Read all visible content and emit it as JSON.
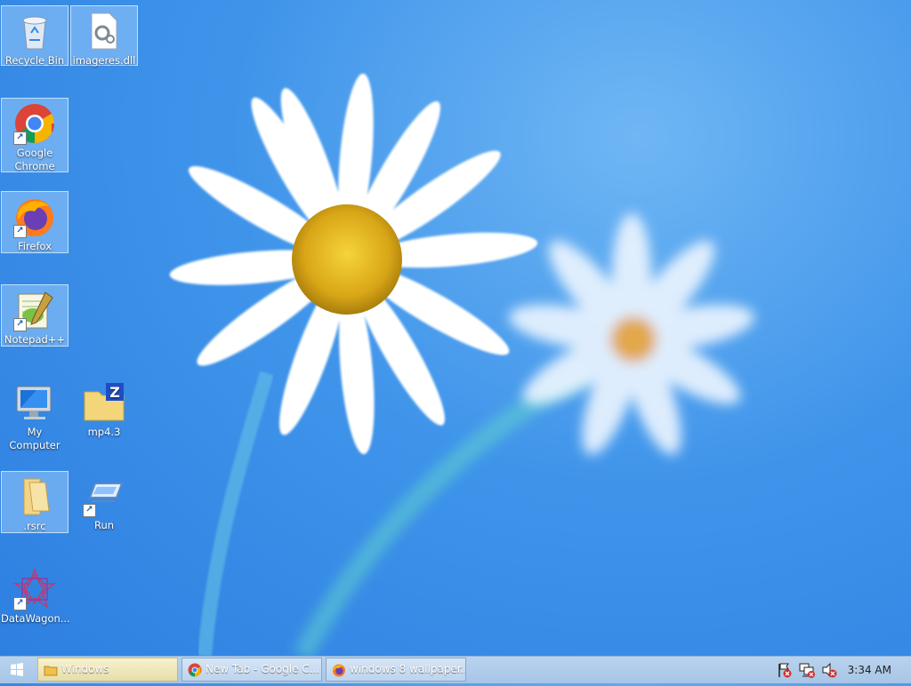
{
  "desktop": {
    "icons": [
      {
        "label": "Recycle Bin",
        "icon": "recycle-bin-icon"
      },
      {
        "label": "imageres.dll",
        "icon": "dll-file-icon"
      },
      {
        "label": "Google Chrome",
        "icon": "chrome-icon"
      },
      {
        "label": "Firefox",
        "icon": "firefox-icon"
      },
      {
        "label": "Notepad++",
        "icon": "notepad-plus-plus-icon"
      },
      {
        "label": "My Computer",
        "icon": "computer-icon"
      },
      {
        "label": "mp4.3",
        "icon": "zip-folder-icon"
      },
      {
        "label": ".rsrc",
        "icon": "folder-icon"
      },
      {
        "label": "Run",
        "icon": "run-icon"
      },
      {
        "label": "DataWagon...",
        "icon": "datawagon-icon"
      }
    ]
  },
  "taskbar": {
    "start_icon": "windows-logo-icon",
    "buttons": [
      {
        "label": "Windows",
        "icon": "folder-icon"
      },
      {
        "label": "New Tab - Google C...",
        "icon": "chrome-icon"
      },
      {
        "label": "windows 8 wallpaper...",
        "icon": "firefox-icon"
      }
    ],
    "tray": {
      "icons": [
        "action-center-flag-icon",
        "network-icon",
        "volume-muted-icon"
      ],
      "time": "3:34 AM"
    }
  },
  "colors": {
    "wallpaper_blue": "#3f94ea",
    "taskbar": "#a7c5e6",
    "active_button": "#e7ddab"
  }
}
